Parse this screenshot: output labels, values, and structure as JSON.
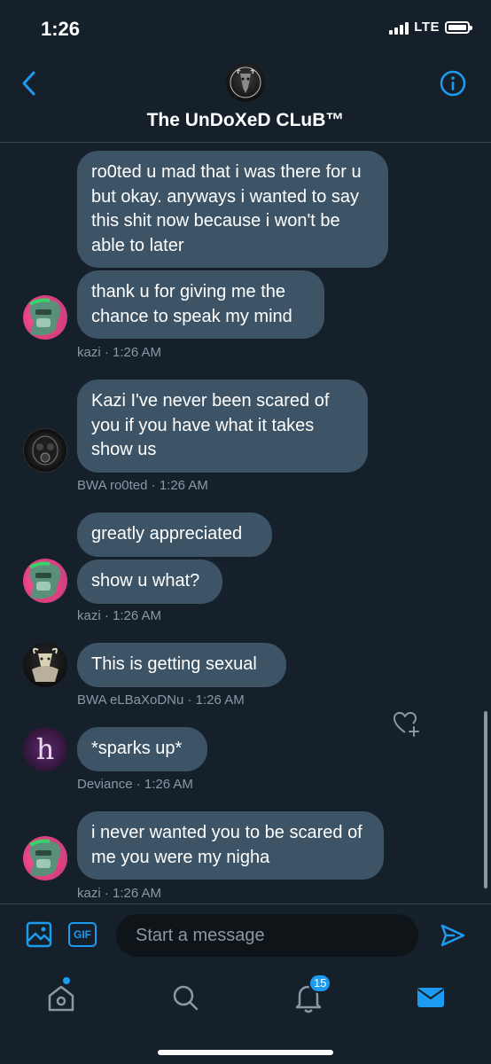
{
  "status": {
    "time": "1:26",
    "network": "LTE"
  },
  "header": {
    "title": "The UnDoXeD CLuB™"
  },
  "messages": [
    {
      "text": "ro0ted u mad that i was there for u but okay. anyways i wanted to say this shit now because i won't be able to later"
    },
    {
      "text": "thank u for giving me the chance to speak my mind"
    },
    {
      "meta": "kazi · 1:26 AM"
    },
    {
      "text": "Kazi I've never been scared of you if you have what it takes show us"
    },
    {
      "meta": "BWA ro0ted · 1:26 AM"
    },
    {
      "text": "greatly appreciated"
    },
    {
      "text": "show u what?"
    },
    {
      "meta": "kazi · 1:26 AM"
    },
    {
      "text": "This is getting sexual"
    },
    {
      "meta": "BWA eLBaXoDNu · 1:26 AM"
    },
    {
      "text": "*sparks up*",
      "avatar_letter": "h"
    },
    {
      "meta": "Deviance · 1:26 AM"
    },
    {
      "text": "i never wanted you to be scared of me you were my nigha"
    },
    {
      "meta": "kazi · 1:26 AM"
    }
  ],
  "composer": {
    "gif_label": "GIF",
    "placeholder": "Start a message"
  },
  "tabbar": {
    "notifications_count": "15"
  },
  "colors": {
    "background": "#15202b",
    "bubble": "#3d5466",
    "accent": "#1d9bf0",
    "meta_text": "#8899a6"
  }
}
